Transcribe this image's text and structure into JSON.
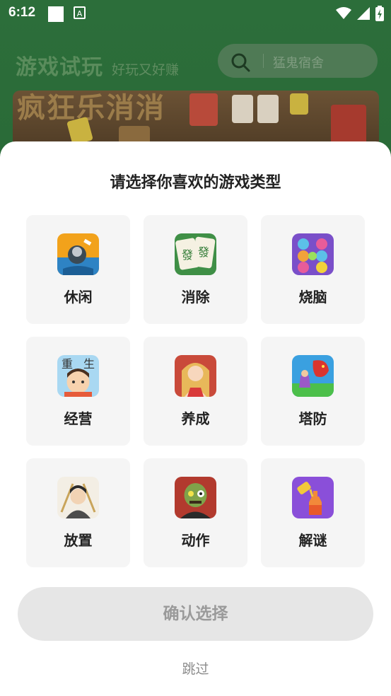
{
  "status_bar": {
    "time": "6:12"
  },
  "background_app": {
    "title": "游戏试玩",
    "subtitle": "好玩又好赚",
    "search_placeholder": "猛鬼宿舍",
    "banner_text": "疯狂乐消消"
  },
  "sheet": {
    "title": "请选择你喜欢的游戏类型",
    "categories": [
      {
        "label": "休闲",
        "icon": "casual-game-icon"
      },
      {
        "label": "消除",
        "icon": "mahjong-tiles-icon"
      },
      {
        "label": "烧脑",
        "icon": "color-rings-puzzle-icon"
      },
      {
        "label": "经营",
        "icon": "boy-character-icon"
      },
      {
        "label": "养成",
        "icon": "girl-character-icon"
      },
      {
        "label": "塔防",
        "icon": "dragon-tower-defense-icon"
      },
      {
        "label": "放置",
        "icon": "warrior-character-icon"
      },
      {
        "label": "动作",
        "icon": "zombie-icon"
      },
      {
        "label": "解谜",
        "icon": "bottle-puzzle-icon"
      }
    ],
    "confirm_label": "确认选择",
    "skip_label": "跳过"
  },
  "colors": {
    "header_green": "#2c6e3a",
    "card_bg": "#f5f5f5",
    "button_disabled_bg": "#e6e6e6",
    "button_disabled_text": "#9a9a9a"
  }
}
